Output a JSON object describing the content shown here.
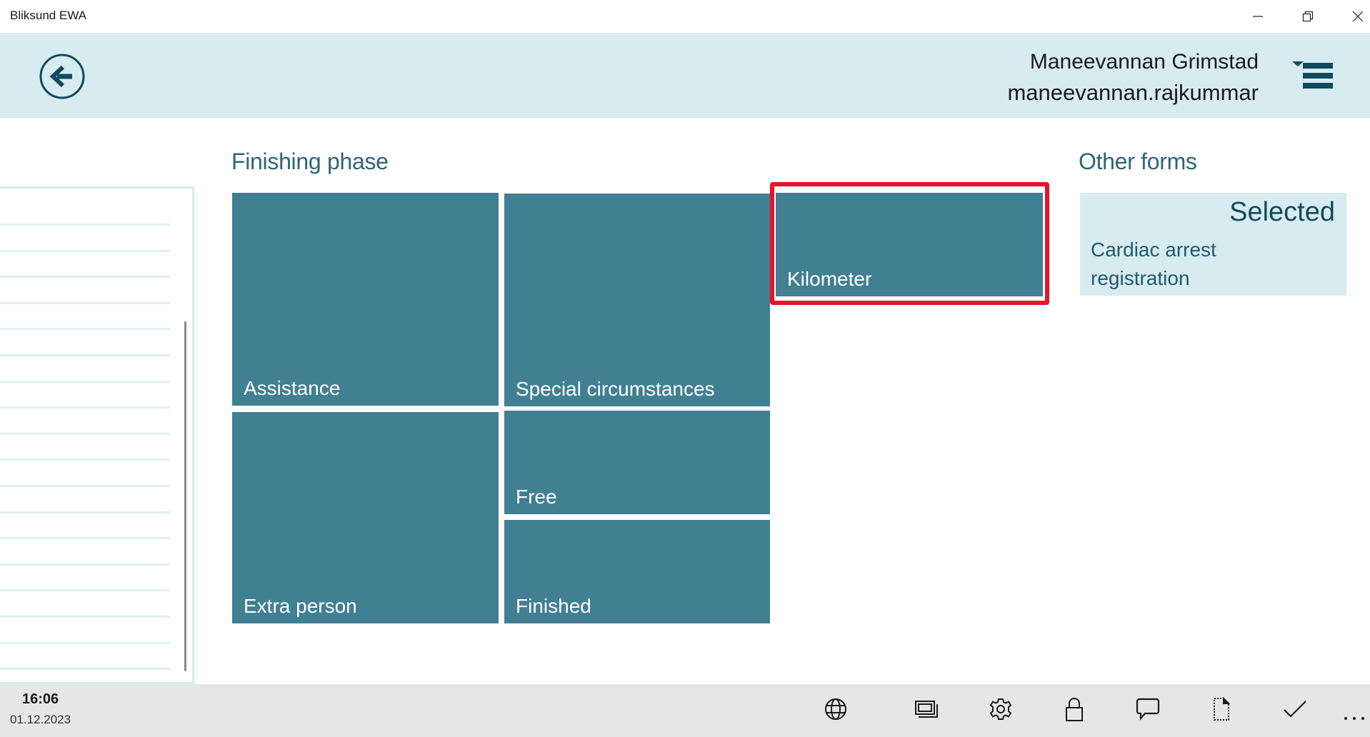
{
  "window": {
    "title": "Bliksund EWA",
    "controls": [
      "minimize",
      "restore",
      "close"
    ]
  },
  "header": {
    "back_icon": "back-arrow-circle-icon",
    "user_name": "Maneevannan Grimstad",
    "user_login": "maneevannan.rajkummar",
    "menu_icon": "hamburger-menu-icon"
  },
  "left_panel": {
    "rows": 18
  },
  "finishing_phase": {
    "title": "Finishing phase",
    "tiles": [
      {
        "id": "assistance",
        "label": "Assistance"
      },
      {
        "id": "special-circumstances",
        "label": "Special circumstances"
      },
      {
        "id": "kilometer",
        "label": "Kilometer",
        "highlighted": true
      },
      {
        "id": "extra-person",
        "label": "Extra person"
      },
      {
        "id": "free",
        "label": "Free"
      },
      {
        "id": "finished",
        "label": "Finished"
      }
    ],
    "tile_color": "#417f93",
    "highlight_color": "#e5132b"
  },
  "other_forms": {
    "title": "Other forms",
    "items": [
      {
        "status": "Selected",
        "label": "Cardiac arrest registration"
      }
    ]
  },
  "bottom_bar": {
    "time": "16:06",
    "date": "01.12.2023",
    "buttons": [
      {
        "name": "globe",
        "icon": "globe-icon"
      },
      {
        "name": "windows",
        "icon": "windows-icon"
      },
      {
        "name": "settings",
        "icon": "gear-icon"
      },
      {
        "name": "lock",
        "icon": "lock-icon"
      },
      {
        "name": "comment",
        "icon": "speech-bubble-icon"
      },
      {
        "name": "document",
        "icon": "document-icon"
      },
      {
        "name": "confirm",
        "icon": "checkmark-icon"
      },
      {
        "name": "more",
        "icon": "more-dots-icon"
      }
    ]
  }
}
